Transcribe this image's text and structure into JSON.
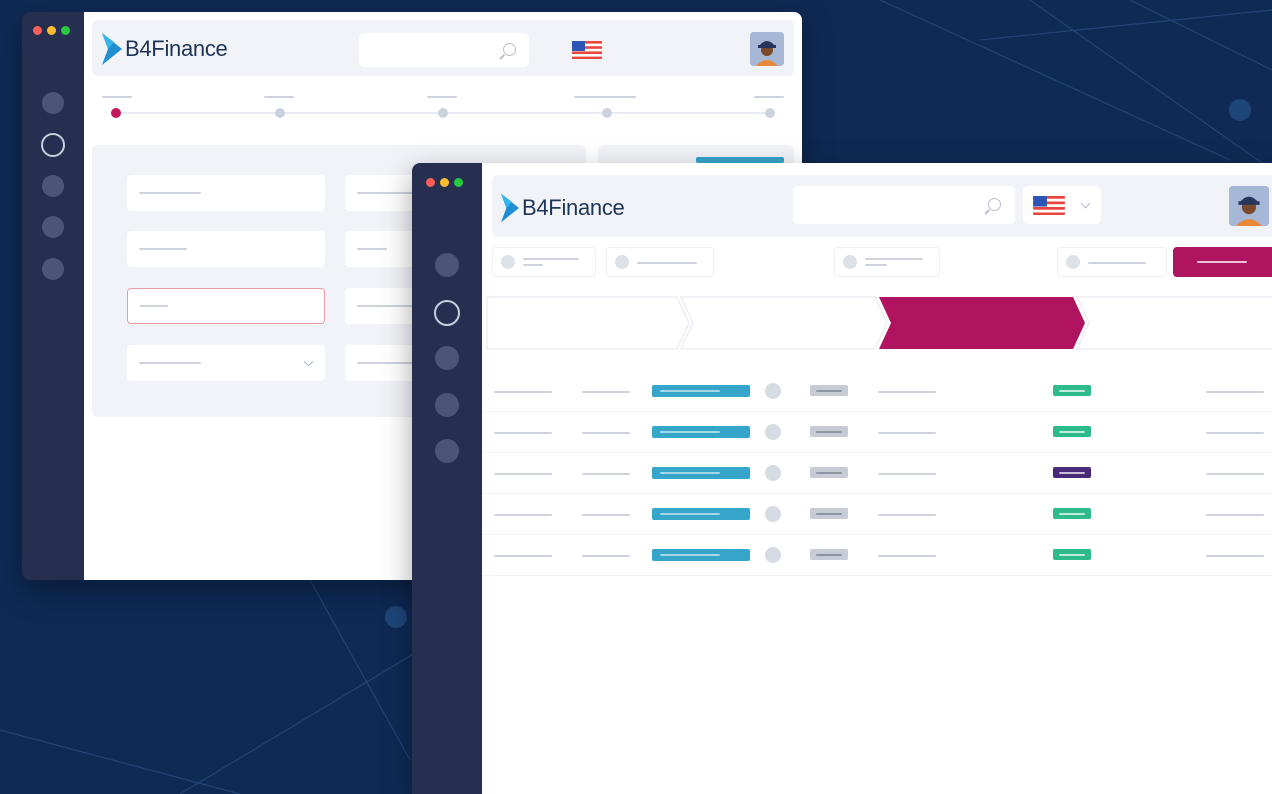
{
  "brand": {
    "name": "B4Finance"
  },
  "colors": {
    "background": "#0f2a55",
    "sidebar": "#262f4f",
    "accent": "#b0135f",
    "teal": "#35a5c9",
    "status_green": "#2dbb8b",
    "status_purple": "#4a2a78",
    "window_dot_red": "#ff5f57",
    "window_dot_yellow": "#febc2e",
    "window_dot_green": "#28c840"
  },
  "icons": [
    "search-icon",
    "us-flag-icon",
    "chevron-down-icon",
    "avatar-icon",
    "b4finance-logo-icon"
  ],
  "back_window": {
    "stepper": {
      "steps": 5,
      "active_step": 1
    },
    "form": {
      "error_field": "row-3-left",
      "dropdown_field": "row-4-left"
    }
  },
  "front_window": {
    "pipeline": {
      "stages": 4,
      "active_stage": 3
    },
    "table": {
      "rows": [
        {
          "status": "green"
        },
        {
          "status": "green"
        },
        {
          "status": "purple"
        },
        {
          "status": "green"
        },
        {
          "status": "green"
        }
      ]
    }
  }
}
